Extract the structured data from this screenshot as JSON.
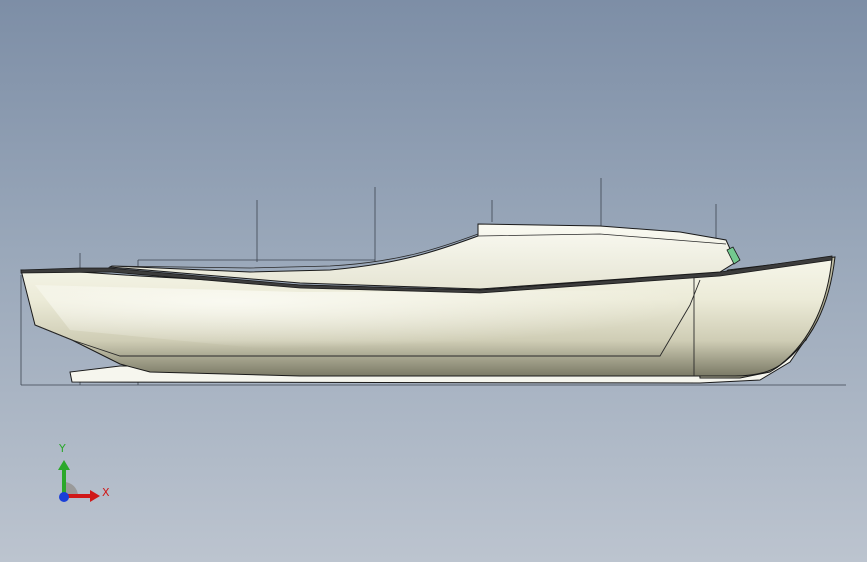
{
  "viewport": {
    "background_top": "#7d8ea6",
    "background_bottom": "#bcc4cf"
  },
  "model": {
    "hull_color": "#f4f4e6",
    "edge_color": "#1a1a1a",
    "light_color": "#73c98f"
  },
  "triad": {
    "x_label": "X",
    "y_label": "Y",
    "x_color": "#d01818",
    "y_color": "#2ba82b",
    "z_color": "#1a3fd8"
  }
}
